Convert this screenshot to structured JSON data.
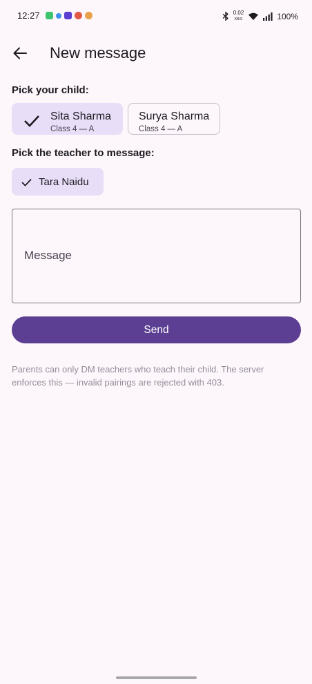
{
  "status": {
    "time": "12:27",
    "net_speed_top": "0.02",
    "net_speed_bottom": "KB/S",
    "battery": "100%"
  },
  "app_bar": {
    "title": "New message"
  },
  "child_section": {
    "label": "Pick your child:",
    "children": [
      {
        "name": "Sita Sharma",
        "class": "Class 4 — A",
        "selected": true
      },
      {
        "name": "Surya Sharma",
        "class": "Class 4 — A",
        "selected": false
      }
    ]
  },
  "teacher_section": {
    "label": "Pick the teacher to message:",
    "teachers": [
      {
        "name": "Tara Naidu",
        "selected": true
      }
    ]
  },
  "message": {
    "placeholder": "Message",
    "value": ""
  },
  "send_label": "Send",
  "hint": "Parents can only DM teachers who teach their child. The server enforces this — invalid pairings are rejected with 403.",
  "colors": {
    "background": "#fdf7fc",
    "chip_selected": "#e8def8",
    "primary_button": "#5c3f92"
  }
}
